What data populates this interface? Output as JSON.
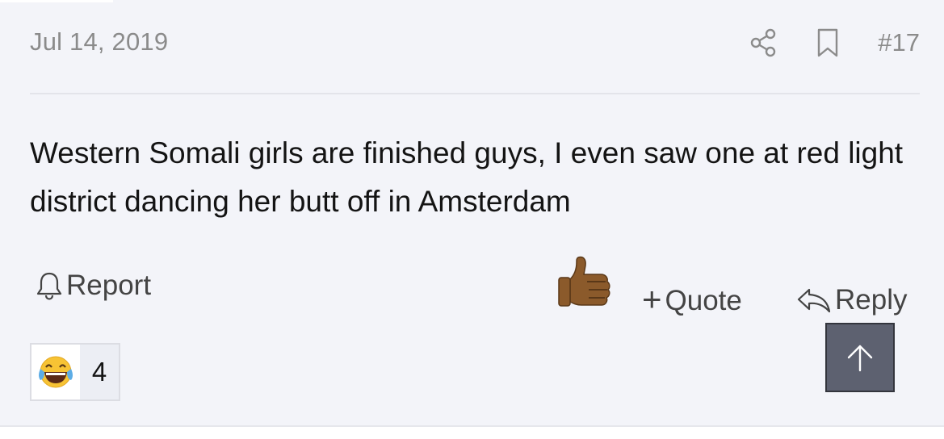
{
  "post": {
    "date": "Jul 14, 2019",
    "number": "#17",
    "body": "Western Somali girls are finished guys, I even saw one at red light district dancing her butt off in Amsterdam"
  },
  "actions": {
    "report_label": "Report",
    "quote_label": "Quote",
    "reply_label": "Reply"
  },
  "icons": {
    "share": "share-icon",
    "bookmark": "bookmark-icon",
    "report": "bell-icon",
    "like": "thumbs-up-icon",
    "reply": "reply-arrow-icon",
    "reaction": "tears-of-joy-emoji",
    "scroll_top": "arrow-up-icon"
  },
  "reactions": [
    {
      "emoji": "laughing-tears",
      "count": "4"
    }
  ],
  "colors": {
    "background": "#f3f4f9",
    "muted_text": "#8b8b8b",
    "scroll_button": "#5d6170"
  }
}
